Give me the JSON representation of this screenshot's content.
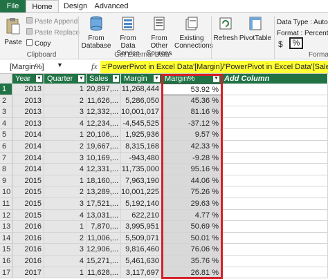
{
  "tabs": {
    "file": "File",
    "home": "Home",
    "design": "Design",
    "advanced": "Advanced"
  },
  "ribbon": {
    "clipboard": {
      "paste": "Paste",
      "paste_append": "Paste Append",
      "paste_replace": "Paste Replace",
      "copy": "Copy",
      "group": "Clipboard"
    },
    "external": {
      "from_database": [
        "From",
        "Database"
      ],
      "from_data_service": [
        "From Data",
        "Service"
      ],
      "from_other_sources": [
        "From Other",
        "Sources"
      ],
      "existing_connections": [
        "Existing",
        "Connections"
      ],
      "group": "Get External Data"
    },
    "refresh": "Refresh",
    "pivottable": "PivotTable",
    "datatype": "Data Type : Auto (D",
    "format": "Format : Percentage",
    "dollar": "$",
    "percent": "%",
    "format_group": "Format"
  },
  "formula_bar": {
    "namebox": "[Margin%]",
    "fx": "fx",
    "formula": "='PowerPivot in Excel Data'[Margin]/'PowerPivot in Excel Data'[Sales]"
  },
  "columns": [
    "Year",
    "Quarter",
    "Sales",
    "Margin",
    "Margin%",
    "Add Column"
  ],
  "rows": [
    {
      "n": "1",
      "year": "2013",
      "quarter": "1",
      "sales": "20,897,...",
      "margin": "11,268,444",
      "pct": "53.92 %"
    },
    {
      "n": "2",
      "year": "2013",
      "quarter": "2",
      "sales": "11,626,...",
      "margin": "5,286,050",
      "pct": "45.36 %"
    },
    {
      "n": "3",
      "year": "2013",
      "quarter": "3",
      "sales": "12,332,...",
      "margin": "10,001,017",
      "pct": "81.16 %"
    },
    {
      "n": "4",
      "year": "2013",
      "quarter": "4",
      "sales": "12,234,...",
      "margin": "-4,545,525",
      "pct": "-37.12 %"
    },
    {
      "n": "5",
      "year": "2014",
      "quarter": "1",
      "sales": "20,106,...",
      "margin": "1,925,936",
      "pct": "9.57 %"
    },
    {
      "n": "6",
      "year": "2014",
      "quarter": "2",
      "sales": "19,667,...",
      "margin": "8,315,168",
      "pct": "42.33 %"
    },
    {
      "n": "7",
      "year": "2014",
      "quarter": "3",
      "sales": "10,169,...",
      "margin": "-943,480",
      "pct": "-9.28 %"
    },
    {
      "n": "8",
      "year": "2014",
      "quarter": "4",
      "sales": "12,331,...",
      "margin": "11,735,000",
      "pct": "95.16 %"
    },
    {
      "n": "9",
      "year": "2015",
      "quarter": "1",
      "sales": "18,160,...",
      "margin": "7,963,190",
      "pct": "44.06 %"
    },
    {
      "n": "10",
      "year": "2015",
      "quarter": "2",
      "sales": "13,289,...",
      "margin": "10,001,225",
      "pct": "75.26 %"
    },
    {
      "n": "11",
      "year": "2015",
      "quarter": "3",
      "sales": "17,521,...",
      "margin": "5,192,140",
      "pct": "29.63 %"
    },
    {
      "n": "12",
      "year": "2015",
      "quarter": "4",
      "sales": "13,031,...",
      "margin": "622,210",
      "pct": "4.77 %"
    },
    {
      "n": "13",
      "year": "2016",
      "quarter": "1",
      "sales": "7,870,...",
      "margin": "3,995,951",
      "pct": "50.69 %"
    },
    {
      "n": "14",
      "year": "2016",
      "quarter": "2",
      "sales": "11,006,...",
      "margin": "5,509,071",
      "pct": "50.01 %"
    },
    {
      "n": "15",
      "year": "2016",
      "quarter": "3",
      "sales": "12,906,...",
      "margin": "9,816,460",
      "pct": "76.06 %"
    },
    {
      "n": "16",
      "year": "2016",
      "quarter": "4",
      "sales": "15,271,...",
      "margin": "5,461,630",
      "pct": "35.76 %"
    },
    {
      "n": "17",
      "year": "2017",
      "quarter": "1",
      "sales": "11,628,...",
      "margin": "3,117,697",
      "pct": "26.81 %"
    }
  ],
  "colors": {
    "accent": "#217346",
    "highlight": "#ffff33",
    "callout": "#d42027"
  }
}
